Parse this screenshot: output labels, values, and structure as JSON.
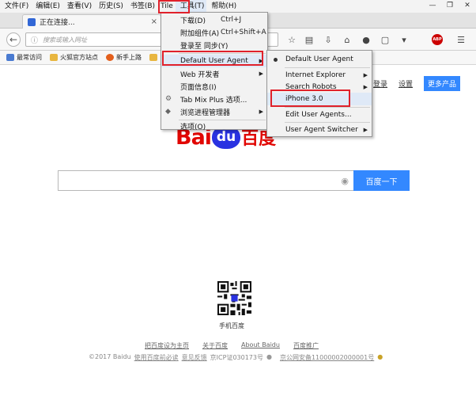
{
  "menubar": {
    "items": [
      "文件(F)",
      "编辑(E)",
      "查看(V)",
      "历史(S)",
      "书签(B)",
      "Tile",
      "工具(T)",
      "帮助(H)"
    ]
  },
  "window_controls": {
    "minimize": "—",
    "restore": "❐",
    "close": "✕"
  },
  "tab": {
    "title": "正在连接...",
    "close": "×"
  },
  "navbar": {
    "url_placeholder": "搜索或输入网址",
    "icons": [
      "star-icon",
      "bookmark-list-icon",
      "download-icon",
      "home-icon",
      "chat-icon",
      "screenshot-icon",
      "abp-icon",
      "menu-icon"
    ],
    "abp_label": "ABP"
  },
  "bookmarks": [
    {
      "label": "最常访问",
      "color": "#4a7bd1"
    },
    {
      "label": "火狐官方站点",
      "color": "#e8b640"
    },
    {
      "label": "新手上路",
      "color": "#e35f1c"
    },
    {
      "label": "",
      "color": "#e8b640"
    }
  ],
  "page": {
    "top_links": [
      "登录",
      "设置"
    ],
    "more_products": "更多产品",
    "logo": {
      "bai": "Bai",
      "du": "du",
      "cn": "百度"
    },
    "search_button": "百度一下",
    "qr_label": "手机百度",
    "footer_links": [
      "把百度设为主页",
      "关于百度",
      "About Baidu",
      "百度推广"
    ],
    "copyright": {
      "prefix": "©2017 Baidu",
      "must_read": "使用百度前必读",
      "feedback": "意见反馈",
      "icp": "京ICP证030173号",
      "police": "京公网安备11000002000001号"
    }
  },
  "tools_menu": {
    "items": [
      {
        "label": "下载(D)",
        "shortcut": "Ctrl+J"
      },
      {
        "label": "附加组件(A)",
        "shortcut": "Ctrl+Shift+A"
      },
      {
        "label": "登录至 同步(Y)"
      },
      {
        "label": "Default User Agent",
        "submenu": true
      },
      {
        "label": "Web 开发者",
        "submenu": true
      },
      {
        "label": "页面信息(I)"
      },
      {
        "label": "Tab Mix Plus 选项..."
      },
      {
        "label": "浏览进程管理器",
        "submenu": true
      },
      {
        "label": "选项(O)"
      }
    ]
  },
  "ua_menu": {
    "items": [
      {
        "label": "Default User Agent",
        "checked": true
      },
      {
        "label": "Internet Explorer",
        "submenu": true
      },
      {
        "label": "Search Robots",
        "submenu": true
      },
      {
        "label": "iPhone 3.0"
      },
      {
        "label": "Edit User Agents..."
      },
      {
        "label": "User Agent Switcher",
        "submenu": true
      }
    ]
  },
  "colors": {
    "accent_blue": "#3388ff",
    "annotation_red": "#e0212b",
    "baidu_red": "#e10602",
    "baidu_blue": "#2932e1"
  }
}
